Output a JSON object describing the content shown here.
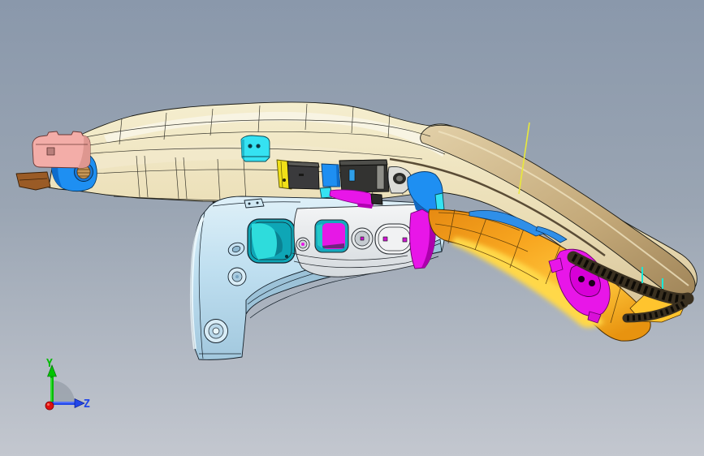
{
  "app": {
    "kind": "cad-3d-viewport"
  },
  "triad": {
    "labels": {
      "y": "Y",
      "z": "Z"
    }
  },
  "colors": {
    "bg_top": "#8A98AB",
    "bg_bottom": "#C3C7CF",
    "tan_body": "#EADDB5",
    "tan_highlight": "#F8F4E3",
    "tan_cream": "#F2E9CB",
    "tan_lip": "#D9C49A",
    "khaki_rail": "#C9AF82",
    "serration_dark": "#3A3020",
    "serration_slot": "#0E0B06",
    "gold_tip": "#FFC42E",
    "arch_blue": "#BFDFF0",
    "arch_flange": "#9CC2D8",
    "teal_pocket": "#0EA6B6",
    "teal_bright": "#2EDCDC",
    "panel_white": "#EDEFF0",
    "cyan_part": "#35E2F2",
    "yellow_part": "#F0E018",
    "dark_part": "#3A3A3C",
    "dark_part2": "#333331",
    "blue_part": "#1E8FF2",
    "blue_patch": "#2F8FE8",
    "magenta_part": "#E816E8",
    "magenta_dark": "#AC00AC",
    "orange_rail": "#F29B1D",
    "gold_highlight": "#FFD84A",
    "pink_bracket": "#F3ADA8",
    "brown_part": "#9A5B26",
    "nut_brass": "#C89858",
    "yellow_line": "#E9E93B",
    "axis_y": "#00BB00",
    "axis_z": "#2247E8",
    "axis_origin": "#E01010",
    "triad_arc": "#9AA2AB",
    "outline": "#1A1A14"
  },
  "parts": [
    {
      "id": "upper-rail-assembly",
      "color": "#EADDB5"
    },
    {
      "id": "roof-side-rail",
      "color": "#C9AF82"
    },
    {
      "id": "weld-flange-serration",
      "color": "#3A3020"
    },
    {
      "id": "wheel-arch-panel",
      "color": "#BFDFF0"
    },
    {
      "id": "inner-sill-panel",
      "color": "#EDEFF0"
    },
    {
      "id": "pillar-outer-panel",
      "color": "#F29B1D"
    },
    {
      "id": "front-bracket",
      "color": "#F3ADA8"
    },
    {
      "id": "front-mount",
      "color": "#1E8FF2"
    },
    {
      "id": "lower-hook-bracket",
      "color": "#9A5B26"
    },
    {
      "id": "rail-top-bracket",
      "color": "#35E2F2"
    },
    {
      "id": "shim-part",
      "color": "#F0E018"
    },
    {
      "id": "damper-blocks",
      "color": "#3A3A3C"
    },
    {
      "id": "reinforcement-patches",
      "color": "#E816E8"
    },
    {
      "id": "datum-line",
      "color": "#E9E93B"
    }
  ]
}
